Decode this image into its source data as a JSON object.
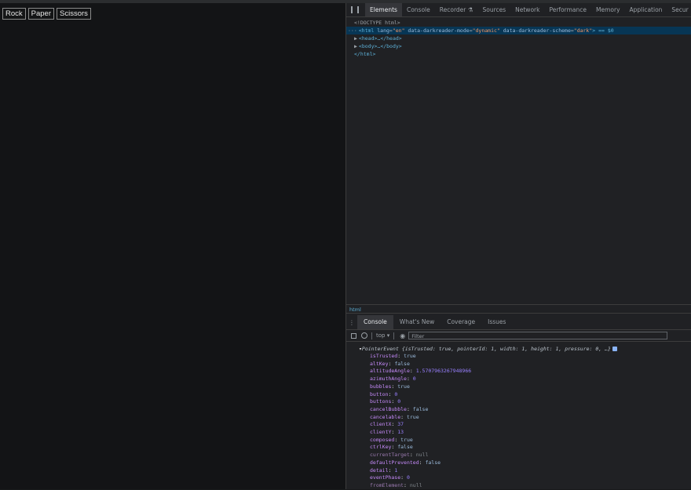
{
  "page": {
    "buttons": [
      "Rock",
      "Paper",
      "Scissors"
    ]
  },
  "devtools": {
    "tabs": [
      "Elements",
      "Console",
      "Recorder ⚗",
      "Sources",
      "Network",
      "Performance",
      "Memory",
      "Application",
      "Secur"
    ],
    "active_tab": "Elements",
    "dom": {
      "doctype": "<!DOCTYPE html>",
      "html_open_tag": "<html",
      "attrs": [
        {
          "name": "lang",
          "value": "\"en\""
        },
        {
          "name": "data-darkreader-mode",
          "value": "\"dynamic\""
        },
        {
          "name": "data-darkreader-scheme",
          "value": "\"dark\""
        }
      ],
      "html_suffix": "> == $0",
      "head": "<head>…</head>",
      "body": "<body>…</body>",
      "html_close": "</html>"
    },
    "breadcrumb": "html",
    "drawer_tabs": [
      "Console",
      "What's New",
      "Coverage",
      "Issues"
    ],
    "drawer_active": "Console",
    "context": "top ▾",
    "filter_placeholder": "Filter",
    "log": {
      "header_name": "PointerEvent",
      "header_preview": "{isTrusted: true, pointerId: 1, width: 1, height: 1, pressure: 0, …}",
      "props": [
        {
          "key": "isTrusted",
          "value": "true",
          "kind": "str"
        },
        {
          "key": "altKey",
          "value": "false",
          "kind": "str"
        },
        {
          "key": "altitudeAngle",
          "value": "1.5707963267948966",
          "kind": "num"
        },
        {
          "key": "azimuthAngle",
          "value": "0",
          "kind": "num"
        },
        {
          "key": "bubbles",
          "value": "true",
          "kind": "str"
        },
        {
          "key": "button",
          "value": "0",
          "kind": "num"
        },
        {
          "key": "buttons",
          "value": "0",
          "kind": "num"
        },
        {
          "key": "cancelBubble",
          "value": "false",
          "kind": "str"
        },
        {
          "key": "cancelable",
          "value": "true",
          "kind": "str"
        },
        {
          "key": "clientX",
          "value": "37",
          "kind": "num"
        },
        {
          "key": "clientY",
          "value": "13",
          "kind": "num"
        },
        {
          "key": "composed",
          "value": "true",
          "kind": "str"
        },
        {
          "key": "ctrlKey",
          "value": "false",
          "kind": "str"
        },
        {
          "key": "currentTarget",
          "value": "null",
          "kind": "null"
        },
        {
          "key": "defaultPrevented",
          "value": "false",
          "kind": "str"
        },
        {
          "key": "detail",
          "value": "1",
          "kind": "num"
        },
        {
          "key": "eventPhase",
          "value": "0",
          "kind": "num"
        },
        {
          "key": "fromElement",
          "value": "null",
          "kind": "null"
        }
      ]
    }
  }
}
